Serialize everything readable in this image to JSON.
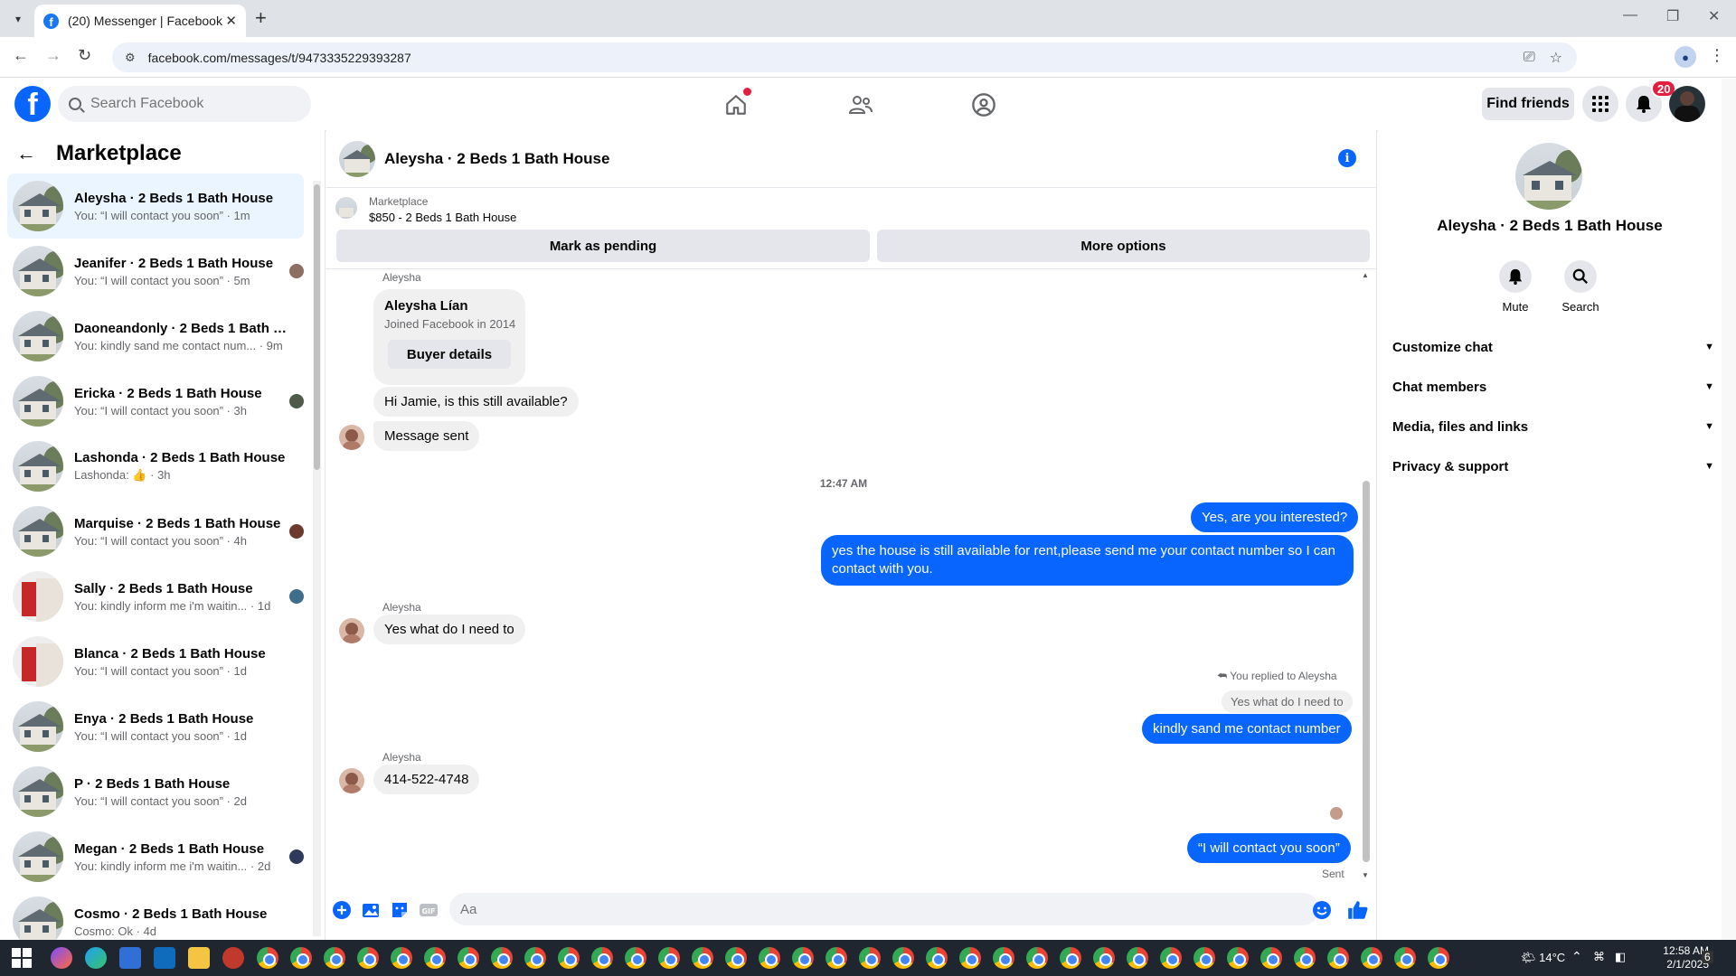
{
  "browser": {
    "tab_title": "(20) Messenger | Facebook",
    "url": "facebook.com/messages/t/9473335229393287"
  },
  "fb_header": {
    "search_placeholder": "Search Facebook",
    "find_friends": "Find friends",
    "notification_count": "20"
  },
  "sidebar": {
    "title": "Marketplace",
    "conversations": [
      {
        "name": "Aleysha · 2 Beds 1 Bath House",
        "preview": "You: “I will contact you soon” · 1m",
        "thumb": "house",
        "active": true
      },
      {
        "name": "Jeanifer · 2 Beds 1 Bath House",
        "preview": "You: “I will contact you soon” · 5m",
        "thumb": "house",
        "mini": "#8d6e63"
      },
      {
        "name": "Daoneandonly · 2 Beds 1 Bath H...",
        "preview": "You: kindly sand me contact num... · 9m",
        "thumb": "house"
      },
      {
        "name": "Ericka · 2 Beds 1 Bath House",
        "preview": "You: “I will contact you soon” · 3h",
        "thumb": "house",
        "mini": "#4e5b4a"
      },
      {
        "name": "Lashonda · 2 Beds 1 Bath House",
        "preview": "Lashonda: 👍 · 3h",
        "thumb": "house"
      },
      {
        "name": "Marquise · 2 Beds 1 Bath House",
        "preview": "You: “I will contact you soon” · 4h",
        "thumb": "house",
        "mini": "#6d3b2e"
      },
      {
        "name": "Sally · 2 Beds 1 Bath House",
        "preview": "You: kindly inform me i'm waitin... · 1d",
        "thumb": "red",
        "mini": "#3f6e8c"
      },
      {
        "name": "Blanca · 2 Beds 1 Bath House",
        "preview": "You: “I will contact you soon” · 1d",
        "thumb": "red"
      },
      {
        "name": "Enya · 2 Beds 1 Bath House",
        "preview": "You: “I will contact you soon” · 1d",
        "thumb": "house"
      },
      {
        "name": "P · 2 Beds 1 Bath House",
        "preview": "You: “I will contact you soon” · 2d",
        "thumb": "house"
      },
      {
        "name": "Megan · 2 Beds 1 Bath House",
        "preview": "You: kindly inform me i'm waitin... · 2d",
        "thumb": "house",
        "mini": "#2f3a5a"
      },
      {
        "name": "Cosmo · 2 Beds 1 Bath House",
        "preview": "Cosmo: Ok · 4d",
        "thumb": "house"
      }
    ]
  },
  "chat": {
    "title": "Aleysha · 2 Beds 1 Bath House",
    "marketplace_label": "Marketplace",
    "listing": "$850 - 2 Beds 1 Bath House",
    "mark_pending": "Mark as pending",
    "more_options": "More options",
    "sender_name": "Aleysha",
    "buyer": {
      "name": "Aleysha Lían",
      "joined": "Joined Facebook in 2014",
      "button": "Buyer details"
    },
    "messages": {
      "in1": "Hi Jamie, is this still available?",
      "in2": "Message sent",
      "time": "12:47 AM",
      "out1": "Yes, are you interested?",
      "out2": "yes the house is still available for rent,please send me your contact number so I can contact with you.",
      "in3": "Yes what do I need to",
      "reply_note": "You replied to Aleysha",
      "reply_quote": "Yes what do I need to",
      "out3": "kindly sand me contact number",
      "in4": "414-522-4748",
      "out4": "“I will contact you soon”",
      "sent": "Sent"
    },
    "composer_placeholder": "Aa"
  },
  "details": {
    "name": "Aleysha · 2 Beds 1 Bath House",
    "mute": "Mute",
    "search": "Search",
    "sections": [
      "Customize chat",
      "Chat members",
      "Media, files and links",
      "Privacy & support"
    ]
  },
  "taskbar": {
    "temperature": "14°C",
    "time": "12:58 AM",
    "date": "2/1/2025",
    "notif": "6"
  }
}
